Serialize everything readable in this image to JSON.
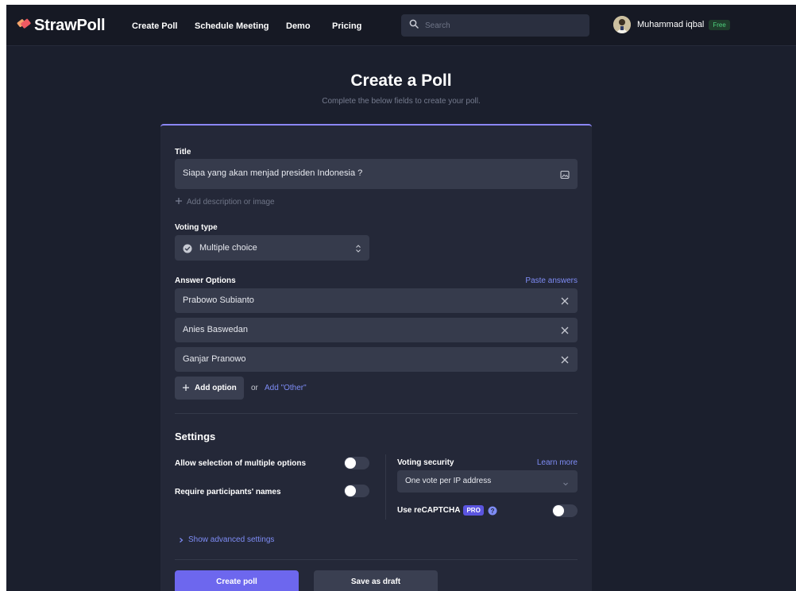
{
  "header": {
    "logo_text": "StrawPoll",
    "nav": [
      {
        "label": "Create Poll"
      },
      {
        "label": "Schedule Meeting"
      },
      {
        "label": "Demo"
      },
      {
        "label": "Pricing"
      }
    ],
    "search_placeholder": "Search",
    "user_name": "Muhammad iqbal",
    "plan_badge": "Free"
  },
  "page": {
    "title": "Create a Poll",
    "subtitle": "Complete the below fields to create your poll."
  },
  "form": {
    "title_label": "Title",
    "title_value": "Siapa yang akan menjad presiden Indonesia ?",
    "add_description": "Add description or image",
    "voting_type_label": "Voting type",
    "voting_type_value": "Multiple choice",
    "answer_options_label": "Answer Options",
    "paste_answers": "Paste answers",
    "options": [
      {
        "value": "Prabowo Subianto"
      },
      {
        "value": "Anies Baswedan"
      },
      {
        "value": "Ganjar Pranowo"
      }
    ],
    "add_option": "Add option",
    "or_text": "or",
    "add_other": "Add \"Other\""
  },
  "settings": {
    "heading": "Settings",
    "allow_multiple": "Allow selection of multiple options",
    "require_names": "Require participants' names",
    "voting_security_label": "Voting security",
    "learn_more": "Learn more",
    "voting_security_value": "One vote per IP address",
    "recaptcha_label": "Use reCAPTCHA",
    "pro_badge": "PRO",
    "show_advanced": "Show advanced settings"
  },
  "actions": {
    "create": "Create poll",
    "draft": "Save as draft"
  },
  "colors": {
    "accent": "#6d67ee",
    "link": "#7e8cf5",
    "background": "#1b1f2d",
    "card": "#242838",
    "brand_logo": "#ef5c60"
  }
}
